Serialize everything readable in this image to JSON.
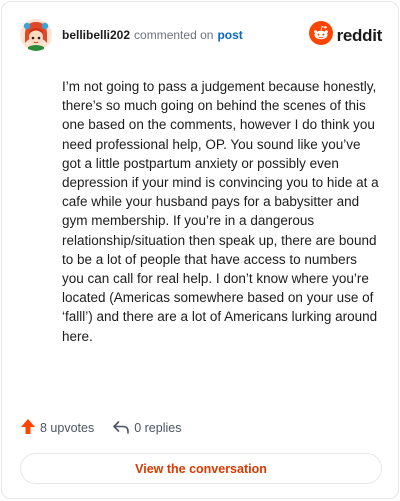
{
  "comment": {
    "username": "bellibelli202",
    "action_text": "commented on",
    "post_link_label": "post",
    "body": "I’m not going to pass a judgement because honestly, there’s so much going on behind the scenes of this one based on the comments, however I do think you need professional help, OP. You sound like you’ve got a little postpartum anxiety or possibly even depression if your mind is convincing you to hide at a cafe while your husband pays for a babysitter and gym membership. If you’re in a dangerous relationship/situation then speak up, there are bound to be a lot of people that have access to numbers you can call for real help. I don’t know where you’re located (Americas somewhere based on your use of ‘falll’) and there are a lot of Americans lurking around here."
  },
  "brand": {
    "name": "reddit",
    "color": "#ff4500",
    "icon": "reddit-logo-icon"
  },
  "actions": {
    "upvotes_label": "8 upvotes",
    "replies_label": "0 replies",
    "upvote_icon": "upvote-arrow-icon",
    "reply_icon": "reply-icon"
  },
  "cta": {
    "label": "View the conversation"
  },
  "colors": {
    "accent": "#ff4500",
    "link": "#0a66c2",
    "cta_text": "#d93900"
  }
}
